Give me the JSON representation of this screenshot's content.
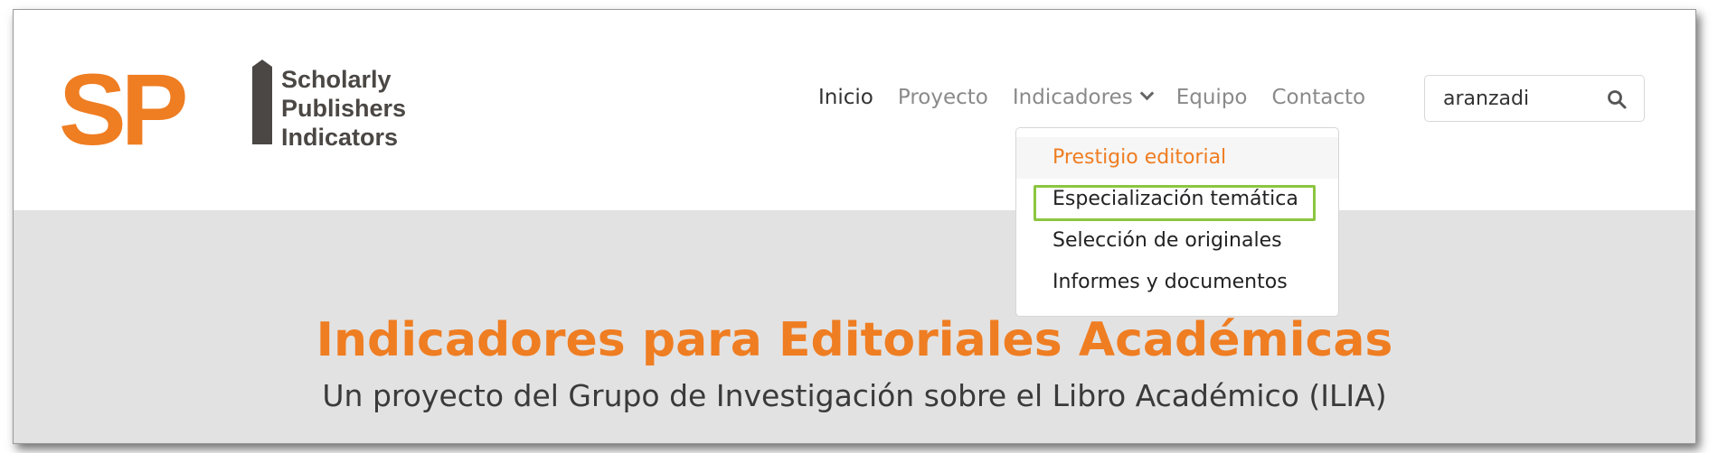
{
  "logo": {
    "letters": "SP",
    "lines": [
      "Scholarly",
      "Publishers",
      "Indicators"
    ],
    "colors": {
      "orange": "#ef7d22",
      "dark": "#4a4744"
    }
  },
  "nav": {
    "items": [
      {
        "label": "Inicio",
        "active": true
      },
      {
        "label": "Proyecto",
        "active": false
      },
      {
        "label": "Indicadores",
        "active": false,
        "has_dropdown": true
      },
      {
        "label": "Equipo",
        "active": false
      },
      {
        "label": "Contacto",
        "active": false
      }
    ]
  },
  "search": {
    "value": "aranzadi",
    "icon": "search-icon"
  },
  "dropdown": {
    "items": [
      {
        "label": "Prestigio editorial",
        "state": "hover"
      },
      {
        "label": "Especialización temática",
        "state": "highlighted"
      },
      {
        "label": "Selección de originales"
      },
      {
        "label": "Informes y documentos"
      }
    ]
  },
  "hero": {
    "title": "Indicadores para Editoriales Académicas",
    "subtitle": "Un proyecto del Grupo de Investigación sobre el Libro Académico (ILIA)"
  },
  "colors": {
    "accent": "#ef7d22",
    "hero_bg": "#e2e2e2",
    "highlight_border": "#8cc540"
  }
}
